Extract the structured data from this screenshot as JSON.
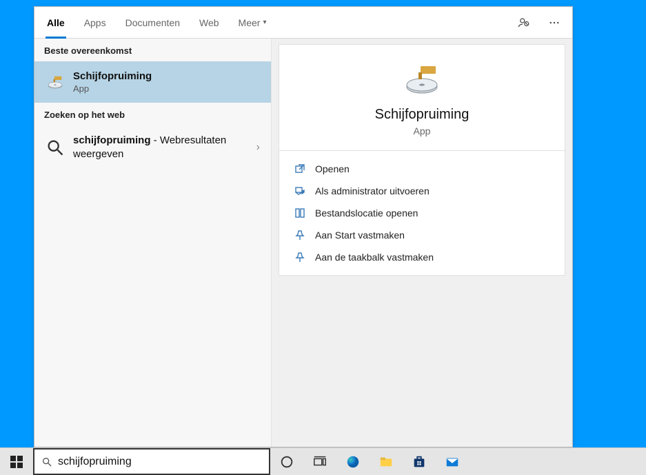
{
  "tabs": {
    "items": [
      {
        "label": "Alle",
        "active": true
      },
      {
        "label": "Apps",
        "active": false
      },
      {
        "label": "Documenten",
        "active": false
      },
      {
        "label": "Web",
        "active": false
      },
      {
        "label": "Meer",
        "active": false,
        "more": true
      }
    ]
  },
  "left": {
    "best_match_heading": "Beste overeenkomst",
    "best_match": {
      "title": "Schijfopruiming",
      "subtitle": "App"
    },
    "web_heading": "Zoeken op het web",
    "web": {
      "query": "schijfopruiming",
      "suffix": " - Webresultaten weergeven"
    }
  },
  "detail": {
    "title": "Schijfopruiming",
    "subtitle": "App",
    "actions": [
      "Openen",
      "Als administrator uitvoeren",
      "Bestandslocatie openen",
      "Aan Start vastmaken",
      "Aan de taakbalk vastmaken"
    ]
  },
  "search": {
    "value": "schijfopruiming"
  }
}
